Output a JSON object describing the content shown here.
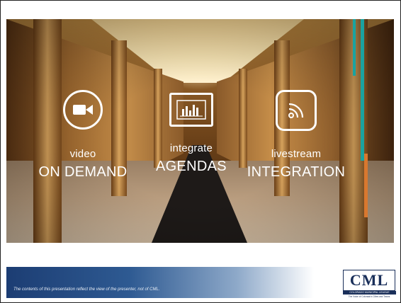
{
  "features": [
    {
      "icon": "video-camera-icon",
      "small": "video",
      "big": "ON DEMAND"
    },
    {
      "icon": "agenda-monitor-icon",
      "small": "integrate",
      "big": "AGENDAS"
    },
    {
      "icon": "rss-feed-icon",
      "small": "livestream",
      "big": "INTEGRATION"
    }
  ],
  "footer": {
    "disclaimer": "The contents of this presentation reflect the view of the presenter, not of CML."
  },
  "logo": {
    "letters": "CML",
    "band": "COLORADO MUNICIPAL LEAGUE",
    "tagline": "The Voice of Colorado's Cities and Towns"
  },
  "colors": {
    "accent_teal": "#1aa3a0",
    "accent_orange": "#d9782f",
    "footer_blue": "#1c3d73",
    "logo_navy": "#1a2f5a"
  }
}
